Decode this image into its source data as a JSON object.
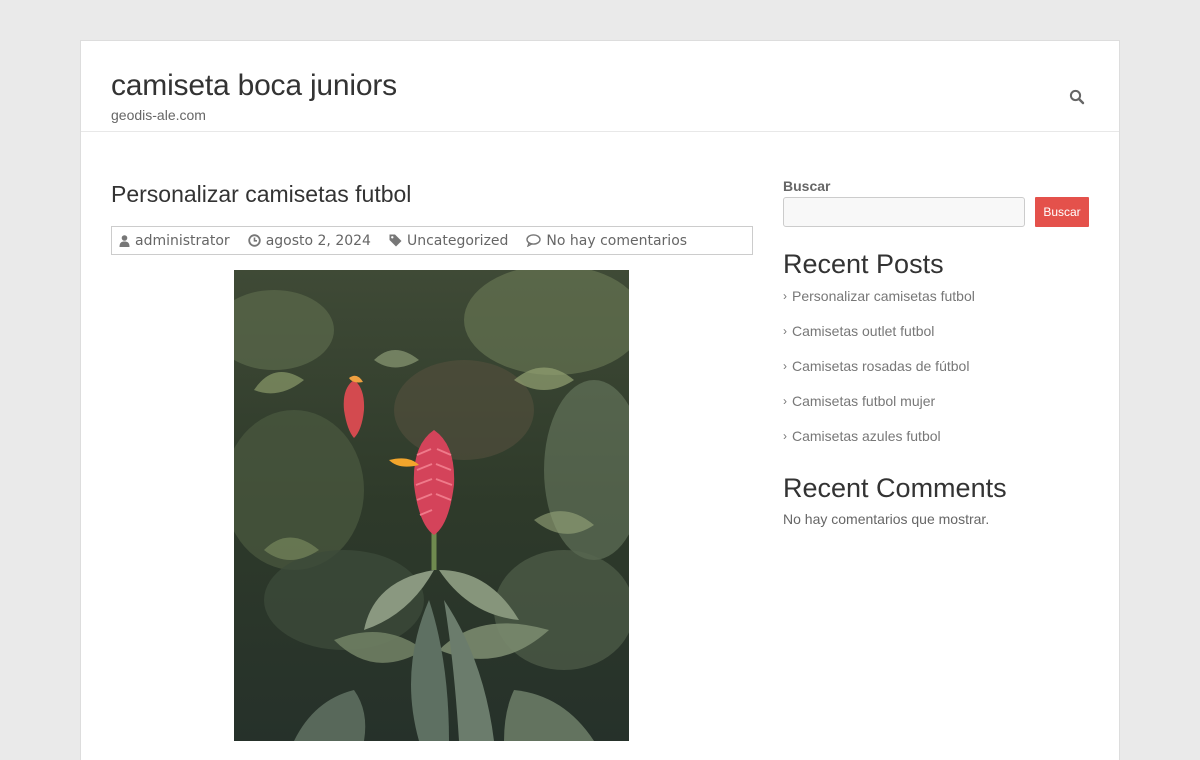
{
  "header": {
    "site_title": "camiseta boca juniors",
    "site_description": "geodis-ale.com"
  },
  "post": {
    "title": "Personalizar camisetas futbol",
    "meta": {
      "author": "administrator",
      "date": "agosto 2, 2024",
      "category": "Uncategorized",
      "comments": "No hay comentarios"
    }
  },
  "sidebar": {
    "search": {
      "label": "Buscar",
      "placeholder": "",
      "button_label": "Buscar"
    },
    "recent_posts": {
      "title": "Recent Posts",
      "items": [
        "Personalizar camisetas futbol",
        "Camisetas outlet futbol",
        "Camisetas rosadas de fútbol",
        "Camisetas futbol mujer",
        "Camisetas azules futbol"
      ]
    },
    "recent_comments": {
      "title": "Recent Comments",
      "empty_text": "No hay comentarios que mostrar."
    }
  },
  "colors": {
    "accent": "#e4514b",
    "background": "#eaeaea",
    "text": "#333333",
    "muted": "#777777"
  }
}
